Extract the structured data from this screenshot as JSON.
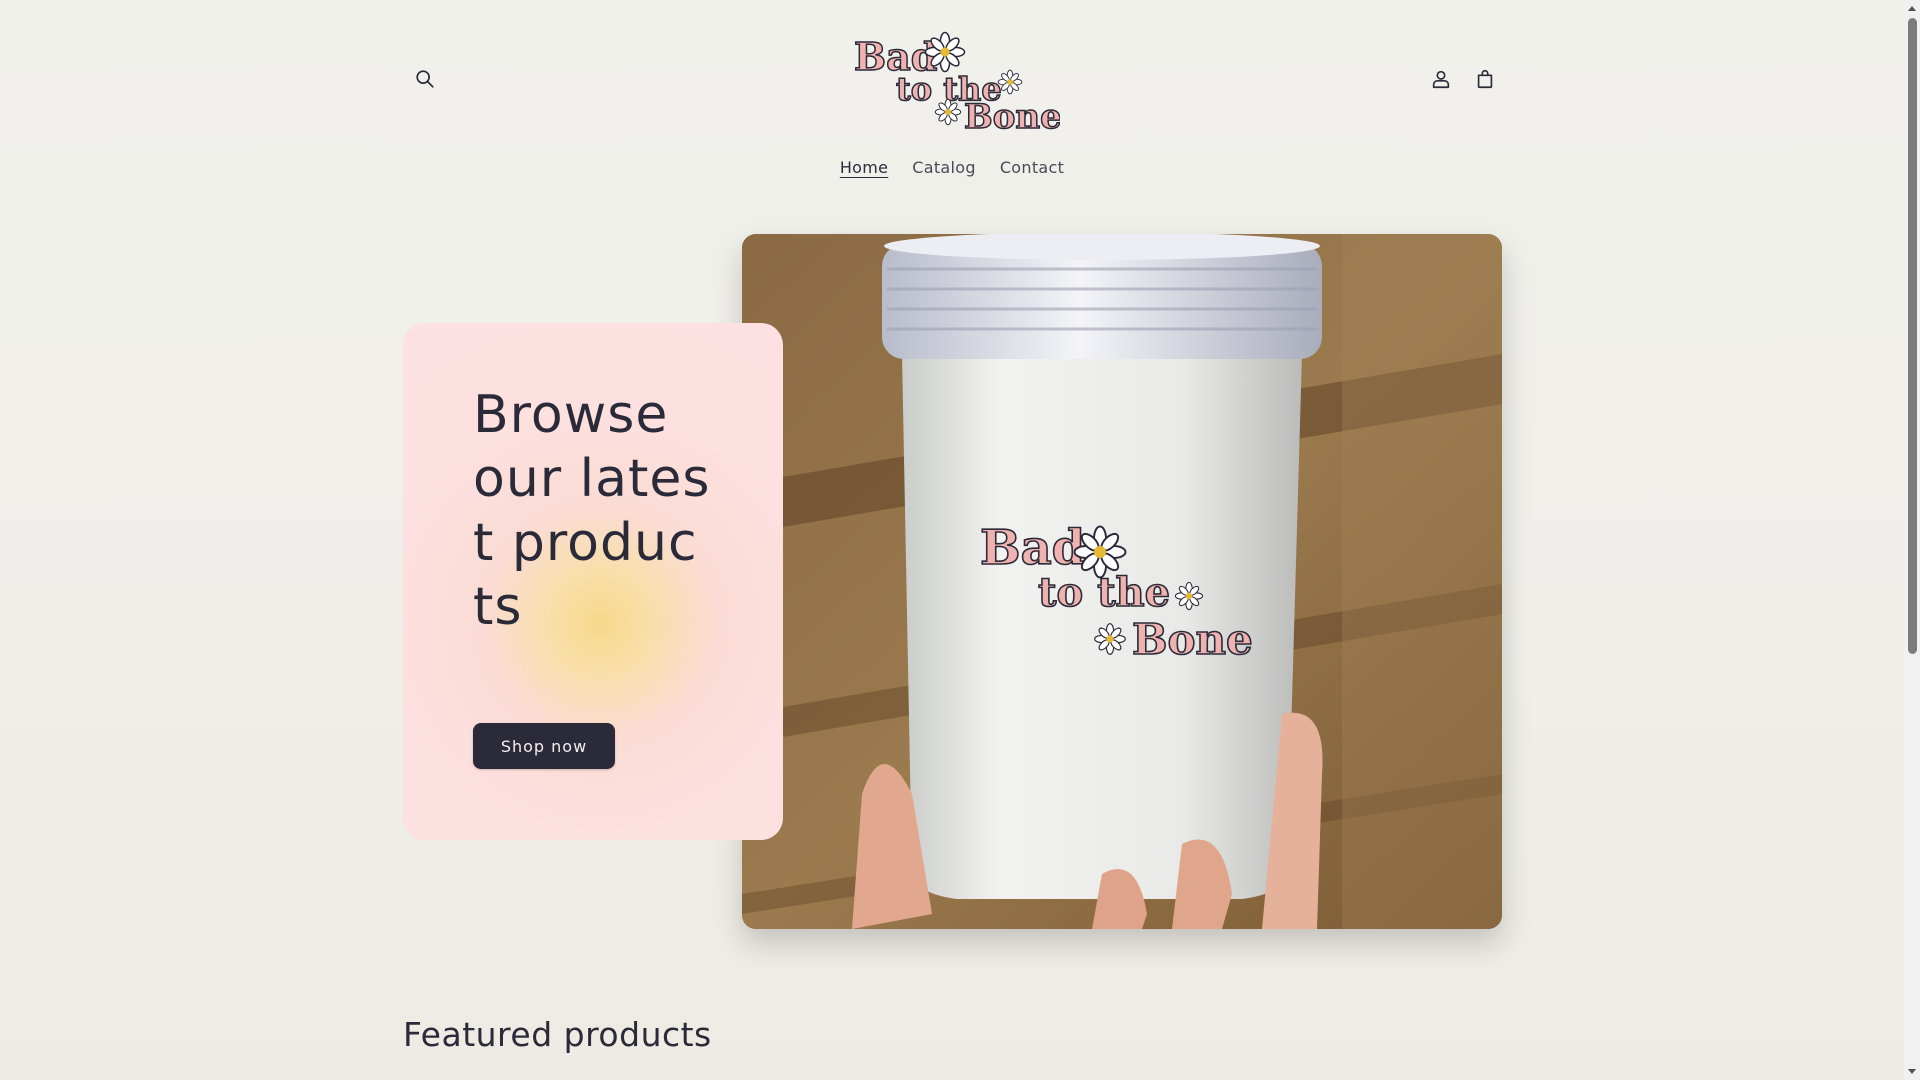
{
  "header": {
    "logo": {
      "line1": "Bad",
      "line2": "to the",
      "line3": "Bone"
    },
    "icons": {
      "search": "search-icon",
      "account": "user-icon",
      "cart": "cart-icon"
    }
  },
  "nav": {
    "items": [
      "Home",
      "Catalog",
      "Contact"
    ],
    "active": "Home"
  },
  "hero": {
    "title": "Browse our latest products",
    "button_label": "Shop now",
    "image_logo": {
      "line1": "Bad",
      "line2": "to the",
      "line3": "Bone"
    }
  },
  "featured": {
    "heading": "Featured products"
  },
  "colors": {
    "text": "#2b2a38",
    "button": "#2b2a38",
    "card": "#fde0e1",
    "logo_pink": "#e9a9a9"
  }
}
